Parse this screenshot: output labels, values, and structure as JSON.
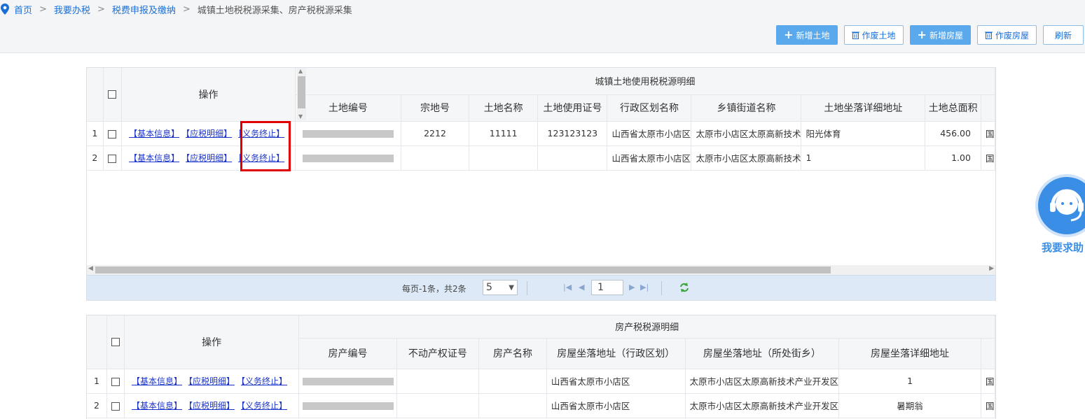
{
  "breadcrumb": {
    "items": [
      "首页",
      "我要办税",
      "税费申报及缴纳"
    ],
    "current": "城镇土地税税源采集、房产税税源采集",
    "separator": ">"
  },
  "toolbar": {
    "add_land": "新增土地",
    "void_land": "作废土地",
    "add_house": "新增房屋",
    "void_house": "作废房屋",
    "refresh": "刷新"
  },
  "land_grid": {
    "operation_header": "操作",
    "group_title": "城镇土地使用税税源明细",
    "columns": [
      "土地编号",
      "宗地号",
      "土地名称",
      "土地使用证号",
      "行政区划名称",
      "乡镇街道名称",
      "土地坐落详细地址",
      "土地总面积"
    ],
    "rows": [
      {
        "rownum": "1",
        "links": [
          "【基本信息】",
          "【应税明细】",
          "【义务终止】"
        ],
        "id_masked": "",
        "parcel_no": "2212",
        "land_name": "11111",
        "cert_no": "123123123",
        "district": "山西省太原市小店区",
        "street": "太原市小店区太原高新技术",
        "address": "阳光体育",
        "area": "456.00",
        "extra": "国"
      },
      {
        "rownum": "2",
        "links": [
          "【基本信息】",
          "【应税明细】",
          "【义务终止】"
        ],
        "id_masked": "",
        "parcel_no": "",
        "land_name": "",
        "cert_no": "",
        "district": "山西省太原市小店区",
        "street": "太原市小店区太原高新技术",
        "address": "1",
        "area": "1.00",
        "extra": "国"
      }
    ],
    "pager": {
      "info": "每页-1条，共2条",
      "page_size": "5",
      "page": "1"
    }
  },
  "house_grid": {
    "operation_header": "操作",
    "group_title": "房产税税源明细",
    "columns": [
      "房产编号",
      "不动产权证号",
      "房产名称",
      "房屋坐落地址（行政区划）",
      "房屋坐落地址（所处街乡）",
      "房屋坐落详细地址"
    ],
    "rows": [
      {
        "rownum": "1",
        "links": [
          "【基本信息】",
          "【应税明细】",
          "【义务终止】"
        ],
        "cert": "",
        "name": "",
        "district": "山西省太原市小店区",
        "street": "太原市小店区太原高新技术产业开发区",
        "address": "1",
        "extra": "国"
      },
      {
        "rownum": "2",
        "links": [
          "【基本信息】",
          "【应税明细】",
          "【义务终止】"
        ],
        "cert": "",
        "name": "",
        "district": "山西省太原市小店区",
        "street": "太原市小店区太原高新技术产业开发区",
        "address": "暑期翁",
        "extra": "国"
      }
    ]
  },
  "service": {
    "label": "我要求助"
  },
  "colors": {
    "link": "#1a6fd6",
    "primary_button": "#5aa9ec",
    "highlight": "#e00000"
  }
}
